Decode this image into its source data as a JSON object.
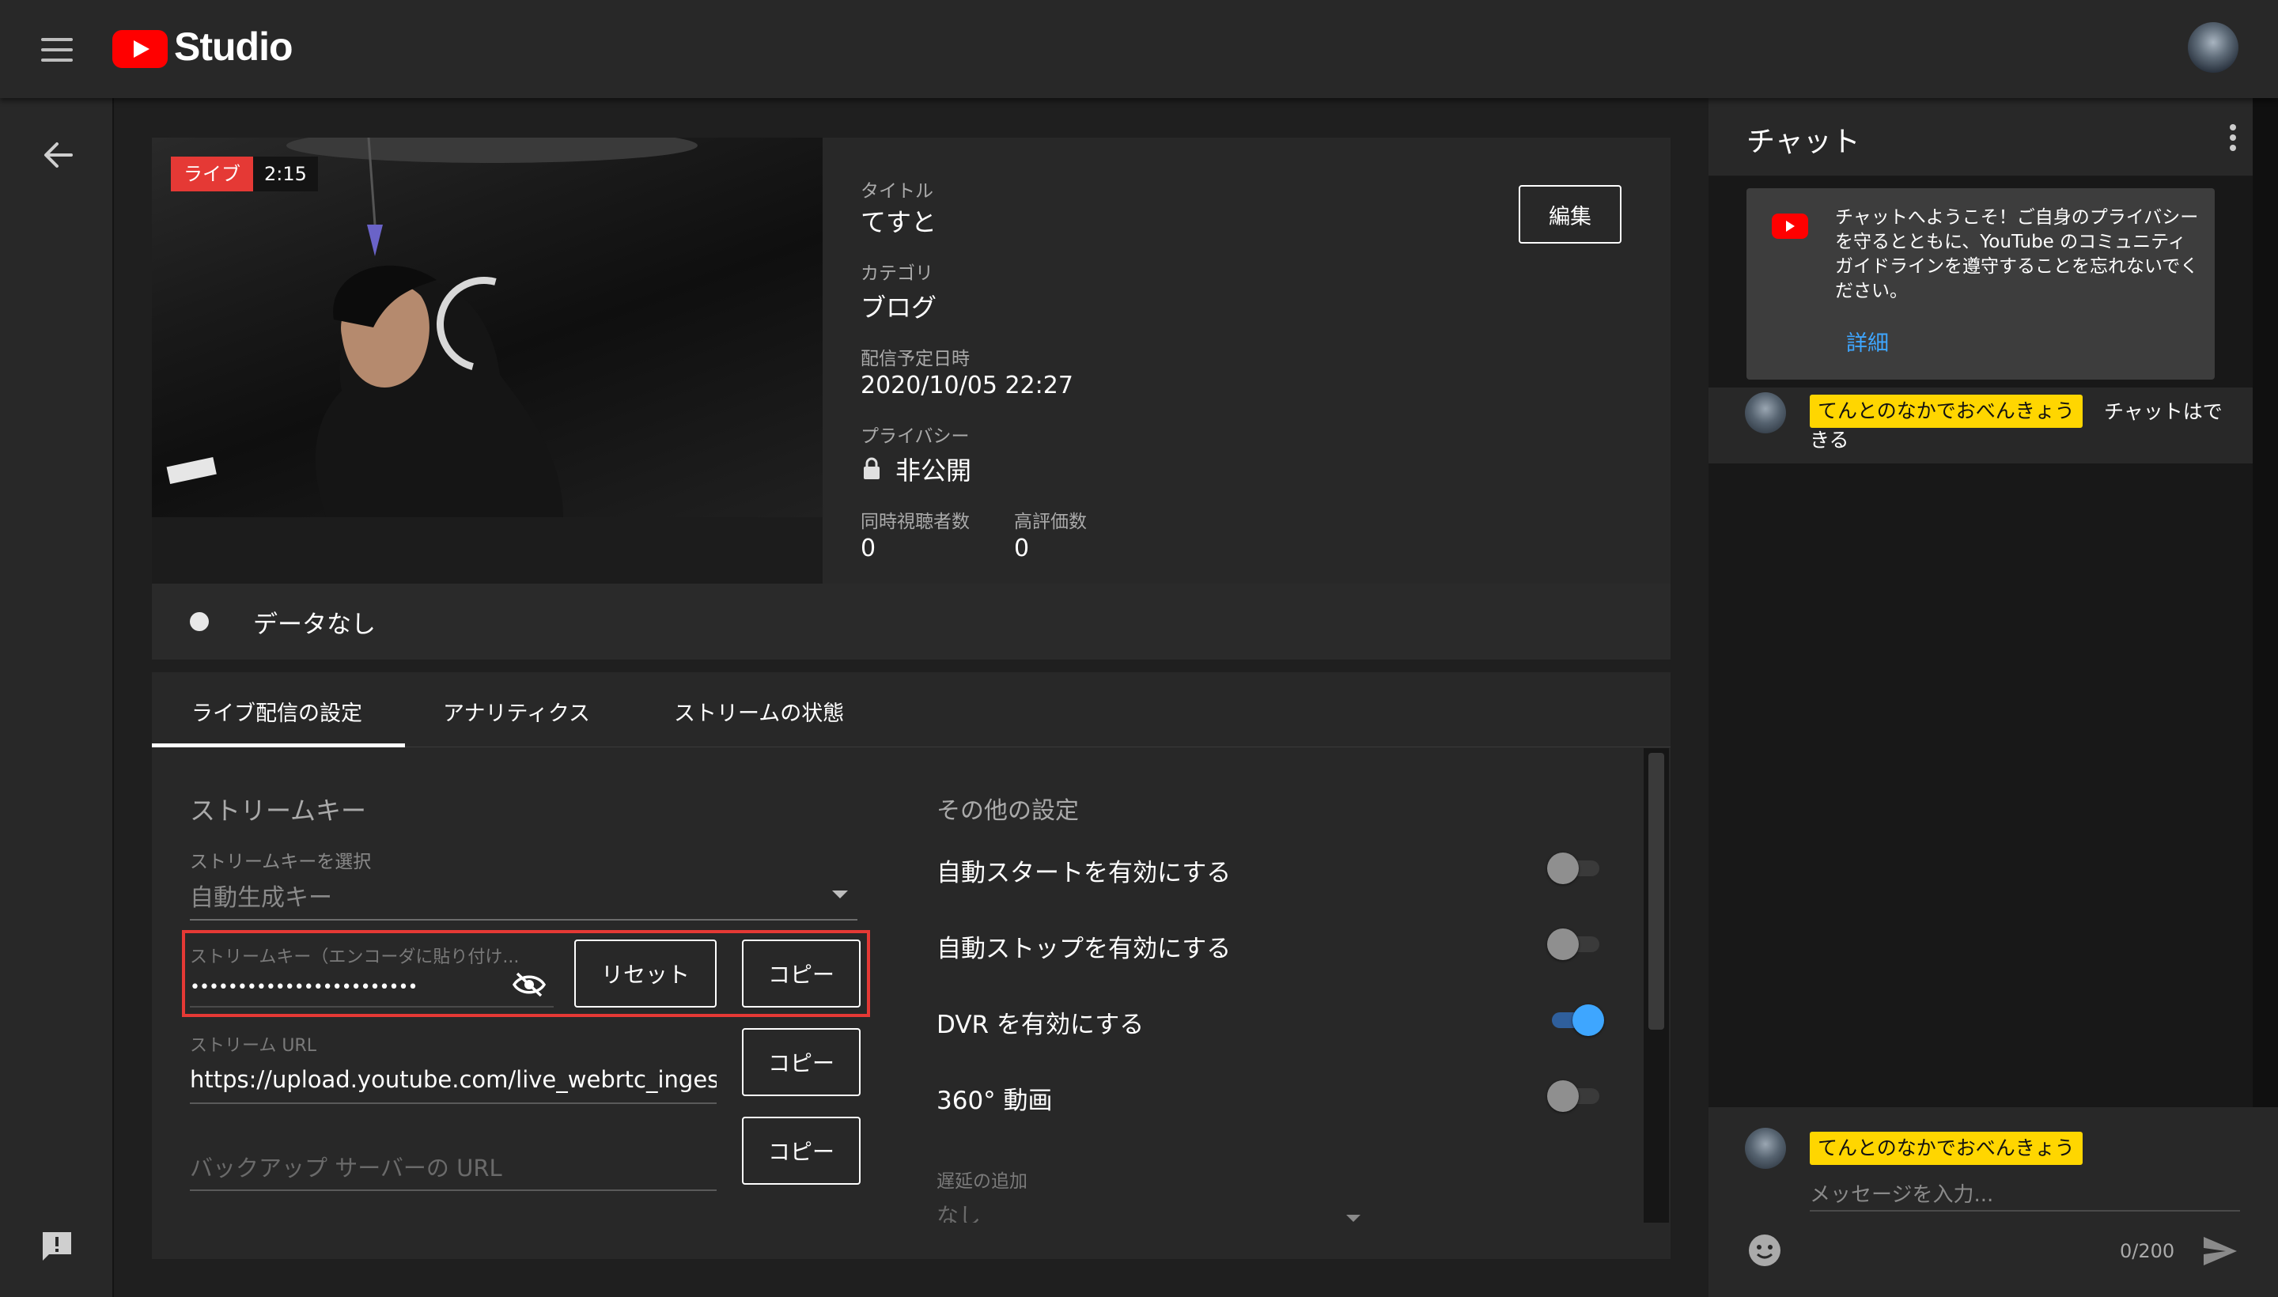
{
  "app": {
    "name": "Studio"
  },
  "colors": {
    "brand_red": "#ff0000",
    "live_red": "#e53935",
    "accent_blue": "#3ea6ff",
    "highlight_yellow": "#ffd600",
    "outline_red": "#e53935"
  },
  "video": {
    "live_label": "ライブ",
    "time": "2:15"
  },
  "details": {
    "title_label": "タイトル",
    "title_value": "てすと",
    "category_label": "カテゴリ",
    "category_value": "ブログ",
    "scheduled_label": "配信予定日時",
    "scheduled_value": "2020/10/05 22:27",
    "privacy_label": "プライバシー",
    "privacy_value": "非公開",
    "viewers_label": "同時視聴者数",
    "viewers_value": "0",
    "likes_label": "高評価数",
    "likes_value": "0",
    "edit_button": "編集"
  },
  "status": {
    "no_data": "データなし"
  },
  "tabs": [
    {
      "label": "ライブ配信の設定",
      "active": true
    },
    {
      "label": "アナリティクス",
      "active": false
    },
    {
      "label": "ストリームの状態",
      "active": false
    }
  ],
  "stream_key": {
    "section_title": "ストリームキー",
    "select_label": "ストリームキーを選択",
    "select_value": "自動生成キー",
    "key_label": "ストリームキー（エンコーダに貼り付け...",
    "key_value": "••••••••••••••••••••••••",
    "reset_button": "リセット",
    "copy_button": "コピー",
    "url_label": "ストリーム URL",
    "url_value": "https://upload.youtube.com/live_webrtc_ingest",
    "backup_placeholder": "バックアップ サーバーの URL"
  },
  "other_settings": {
    "section_title": "その他の設定",
    "items": [
      {
        "label": "自動スタートを有効にする",
        "enabled": false
      },
      {
        "label": "自動ストップを有効にする",
        "enabled": false
      },
      {
        "label": "DVR を有効にする",
        "enabled": true
      },
      {
        "label": "360° 動画",
        "enabled": false
      }
    ],
    "latency_label": "遅延の追加",
    "latency_value": "なし"
  },
  "chat": {
    "title": "チャット",
    "welcome_text": "チャットへようこそ！ご自身のプライバシーを守るとともに、YouTube のコミュニティ ガイドラインを遵守することを忘れないでください。",
    "welcome_link": "詳細",
    "message": {
      "author": "てんとのなかでおべんきょう",
      "text": "チャットはできる"
    },
    "input": {
      "author": "てんとのなかでおべんきょう",
      "placeholder": "メッセージを入力...",
      "counter": "0/200"
    }
  }
}
